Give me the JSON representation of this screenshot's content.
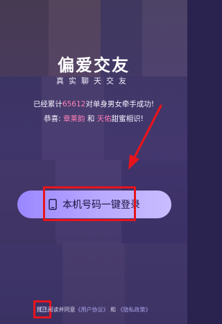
{
  "app": {
    "logo_text": "偏爱交友",
    "slogan": "真实聊天交友"
  },
  "stats": {
    "prefix": "已经累计",
    "count": "65612",
    "suffix": "对单身男女牵手成功!"
  },
  "congrats": {
    "prefix": "恭喜:",
    "name1": "章莱韵",
    "conj": "和",
    "name2": "天佑",
    "suffix": "甜蜜相识!"
  },
  "login": {
    "button_label": "本机号码一键登录",
    "icon": "phone-icon"
  },
  "agreement": {
    "prefix": "我已阅读并同意",
    "user_agreement": "《用户协议》",
    "conj": "和",
    "privacy_policy": "《隐私政策》"
  },
  "colors": {
    "accent_pink": "#ff7fb7",
    "button_gradient_start": "#9a86ff",
    "button_gradient_end": "#c9bcff",
    "annotation_red": "#e8141c"
  }
}
